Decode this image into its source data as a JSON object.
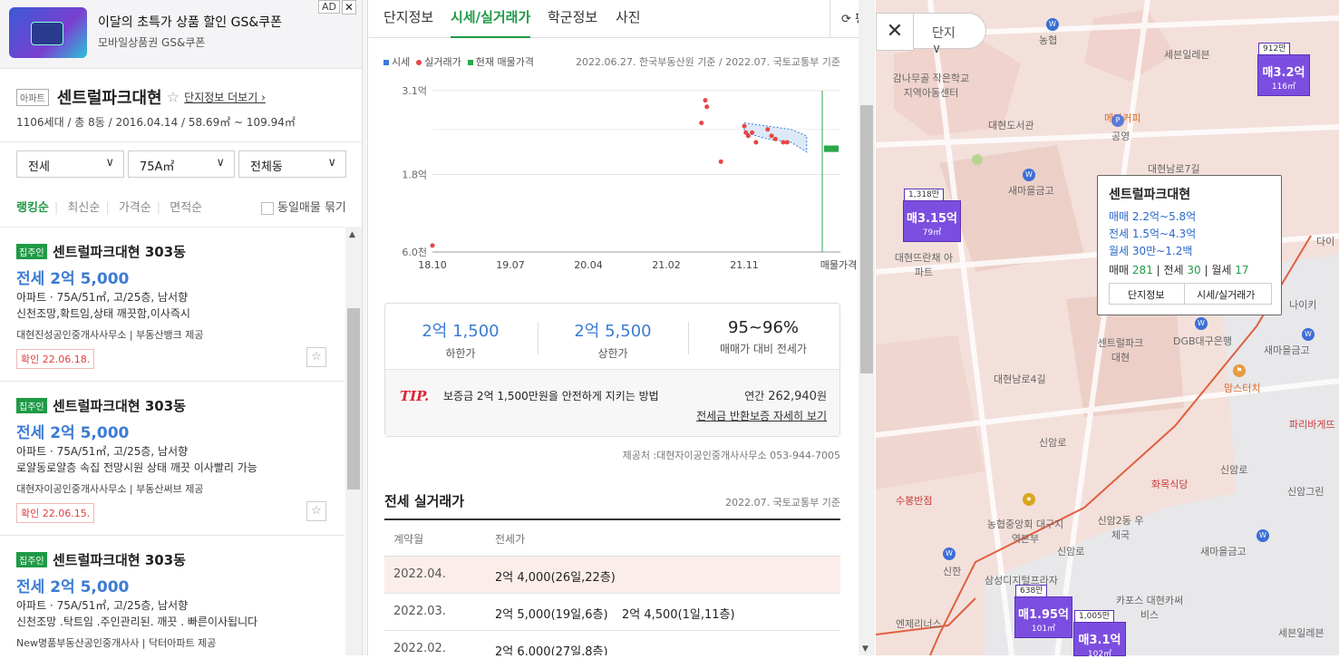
{
  "ad": {
    "title": "이달의 초특가 상품 할인 GS&쿠폰",
    "subtitle": "모바일상품권 GS&쿠폰",
    "tag": "AD",
    "close": "✕"
  },
  "apt": {
    "type": "아파트",
    "name": "센트럴파크대현",
    "star": "☆",
    "more": "단지정보 더보기 ›",
    "meta": "1106세대 / 총 8동 / 2016.04.14 / 58.69㎡ ~ 109.94㎡"
  },
  "filters": {
    "deal": "전세",
    "area": "75A㎡",
    "dong": "전체동",
    "arrow": "∨"
  },
  "sorts": [
    "랭킹순",
    "최신순",
    "가격순",
    "면적순"
  ],
  "group_label": "동일매물 묶기",
  "listings": [
    {
      "badge": "집주인",
      "name": "센트럴파크대현 303동",
      "price": "전세 2억 5,000",
      "desc1": "아파트 · 75A/51㎡, 고/25층, 남서향",
      "desc2": "신천조망,확트임,상태 깨끗함,이사즉시",
      "agency": "대현진성공인중개사사무소 | 부동산뱅크 제공",
      "confirm": "확인 22.06.18."
    },
    {
      "badge": "집주인",
      "name": "센트럴파크대현 303동",
      "price": "전세 2억 5,000",
      "desc1": "아파트 · 75A/51㎡, 고/25층, 남서향",
      "desc2": "로얄동로얄층 속집 전망시원 상태 깨끗 이사빨리 가능",
      "agency": "대현자이공인중개사사무소 | 부동산써브 제공",
      "confirm": "확인 22.06.15."
    },
    {
      "badge": "집주인",
      "name": "센트럴파크대현 303동",
      "price": "전세 2억 5,000",
      "desc1": "아파트 · 75A/51㎡, 고/25층, 남서향",
      "desc2": "신천조망 .탁트임 .주인관리된. 깨끗 . 빠른이사됩니다",
      "agency": "New명품부동산공인중개사사 | 닥터아파트 제공",
      "confirm": ""
    }
  ],
  "tabs": [
    "단지정보",
    "시세/실거래가",
    "학군정보",
    "사진"
  ],
  "tab_extra": "⟳ 평",
  "legend": {
    "market": "시세",
    "actual": "실거래가",
    "current": "현재 매물가격"
  },
  "basis": "2022.06.27. 한국부동산원 기준 / 2022.07. 국토교통부 기준",
  "chart_data": {
    "type": "scatter",
    "title": "",
    "x_ticks": [
      "18.10",
      "19.07",
      "20.04",
      "21.02",
      "21.11",
      "매물가격"
    ],
    "y_ticks": [
      "3.1억",
      "1.8억",
      "6.0천"
    ],
    "ylim": [
      0.6,
      3.1
    ],
    "y_unit": "억",
    "series": [
      {
        "name": "실거래가",
        "color": "#e84545",
        "points": [
          [
            0.0,
            0.7
          ],
          [
            3.5,
            2.95
          ],
          [
            3.52,
            2.85
          ],
          [
            3.45,
            2.6
          ],
          [
            3.7,
            2.0
          ],
          [
            4.0,
            2.55
          ],
          [
            4.02,
            2.45
          ],
          [
            4.05,
            2.4
          ],
          [
            4.1,
            2.45
          ],
          [
            4.15,
            2.3
          ],
          [
            4.3,
            2.5
          ],
          [
            4.35,
            2.4
          ],
          [
            4.4,
            2.35
          ],
          [
            4.5,
            2.3
          ],
          [
            4.55,
            2.3
          ]
        ]
      },
      {
        "name": "시세",
        "color": "#3c7bd6",
        "band": [
          [
            4.0,
            2.45,
            2.6
          ],
          [
            4.3,
            2.35,
            2.55
          ],
          [
            4.6,
            2.3,
            2.5
          ],
          [
            4.8,
            2.15,
            2.4
          ]
        ]
      },
      {
        "name": "현재 매물가격",
        "color": "#2aa84a",
        "range": [
          2.15,
          2.25
        ]
      }
    ],
    "grid": true
  },
  "summary": {
    "low": "2억 1,500",
    "low_label": "하한가",
    "high": "2억 5,500",
    "high_label": "상한가",
    "ratio": "95~96%",
    "ratio_label": "매매가 대비 전세가",
    "tip": "TIP.",
    "tip_text": "보증금 2억 1,500만원을 안전하게 지키는 방법",
    "annual_label": "연간",
    "annual_value": "262,940",
    "annual_unit": "원",
    "link": "전세금 반환보증 자세히 보기"
  },
  "provider": "제공처 :대현자이공인중개사사무소 053-944-7005",
  "recent": {
    "title": "전세 실거래가",
    "basis": "2022.07. 국토교통부 기준",
    "col1": "계약월",
    "col2": "전세가",
    "rows": [
      {
        "month": "2022.04.",
        "p1": "2억 4,000(26일,22층)",
        "p2": ""
      },
      {
        "month": "2022.03.",
        "p1": "2억 5,000(19일,6층)",
        "p2": "2억 4,500(1일,11층)"
      },
      {
        "month": "2022.02.",
        "p1": "2억 6,000(27일,8층)",
        "p2": ""
      }
    ]
  },
  "map": {
    "close": "✕",
    "select": "단지",
    "popup": {
      "name": "센트럴파크대현",
      "sale": "매매 2.2억~5.8억",
      "jeonse": "전세 1.5억~4.3억",
      "monthly": "월세 30만~1.2백",
      "cnt_sale_label": "매매",
      "cnt_sale": "281",
      "cnt_jeonse_label": "전세",
      "cnt_jeonse": "30",
      "cnt_monthly_label": "월세",
      "cnt_monthly": "17",
      "btn1": "단지정보",
      "btn2": "시세/실거래가"
    },
    "markers": [
      {
        "top": "912만",
        "val": "매3.2억",
        "area": "116㎡"
      },
      {
        "top": "1,318만",
        "val": "매3.15억",
        "area": "79㎡"
      },
      {
        "top": "638만",
        "val": "매1.95억",
        "area": "101㎡"
      },
      {
        "top": "1,005만",
        "val": "매3.1억",
        "area": "102㎡"
      }
    ],
    "labels": [
      "농협",
      "세븐일레븐",
      "감나무골 작은학교 지역아동센터",
      "대현도서관",
      "메가커피",
      "공영",
      "대현남로7길",
      "새마을금고",
      "대현뜨란채 아파트",
      "센트럴파크 대현",
      "DGB대구은행",
      "맘스터치",
      "대현남로4길",
      "신암로",
      "파리바게뜨",
      "화목식당",
      "수봉반점",
      "농협중앙회 대구지역본부",
      "신암2동 우체국",
      "새마을금고",
      "신한",
      "삼성디지털프라자",
      "카포스 대현카써비스",
      "엔제리너스",
      "세븐일레븐",
      "나이키",
      "다이",
      "신암그린",
      "신암로",
      "새마을금고",
      "신암로"
    ]
  }
}
